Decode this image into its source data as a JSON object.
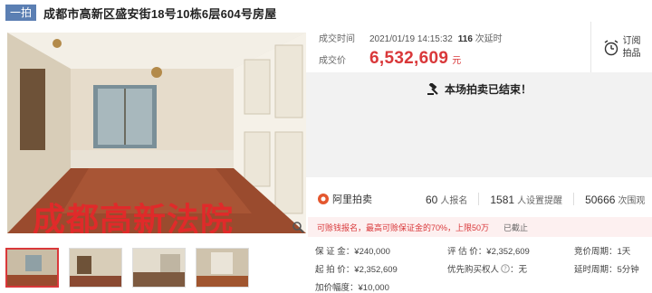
{
  "header": {
    "tag": "一拍",
    "title": "成都市高新区盛安街18号10栋6层604号房屋"
  },
  "deal": {
    "time_label": "成交时间",
    "time_value": "2021/01/19 14:15:32",
    "extensions_count": "116",
    "extensions_suffix": "次延时",
    "price_label": "成交价",
    "price_value": "6,532,609",
    "price_unit": "元"
  },
  "subscribe": {
    "line1": "订阅",
    "line2": "拍品"
  },
  "status": {
    "ended_text": "本场拍卖已结束！"
  },
  "image": {
    "watermark": "成都高新法院"
  },
  "stats": {
    "brand": "阿里拍卖",
    "signups_count": "60",
    "signups_label": "人报名",
    "reminders_count": "1581",
    "reminders_label": "人设置提醒",
    "views_count": "50666",
    "views_label": "次围观"
  },
  "notice": {
    "text": "可赊钱报名，最高可赊保证金的70%，上限50万",
    "status": "已截止"
  },
  "info": {
    "deposit_label": "保 证 金：",
    "deposit_value": "¥240,000",
    "start_label": "起 拍 价：",
    "start_value": "¥2,352,609",
    "increment_label": "加价幅度：",
    "increment_value": "¥10,000",
    "appraisal_label": "评 估 价：",
    "appraisal_value": "¥2,352,609",
    "priority_label": "优先购买权人",
    "priority_value": "：无",
    "cycle_label": "竞价周期：",
    "cycle_value": "1天",
    "delay_label": "延时周期：",
    "delay_value": "5分钟"
  },
  "colors": {
    "accent": "#d9383a",
    "tag_bg": "#5b7fb3",
    "ended_bg": "#f2f2f2"
  }
}
